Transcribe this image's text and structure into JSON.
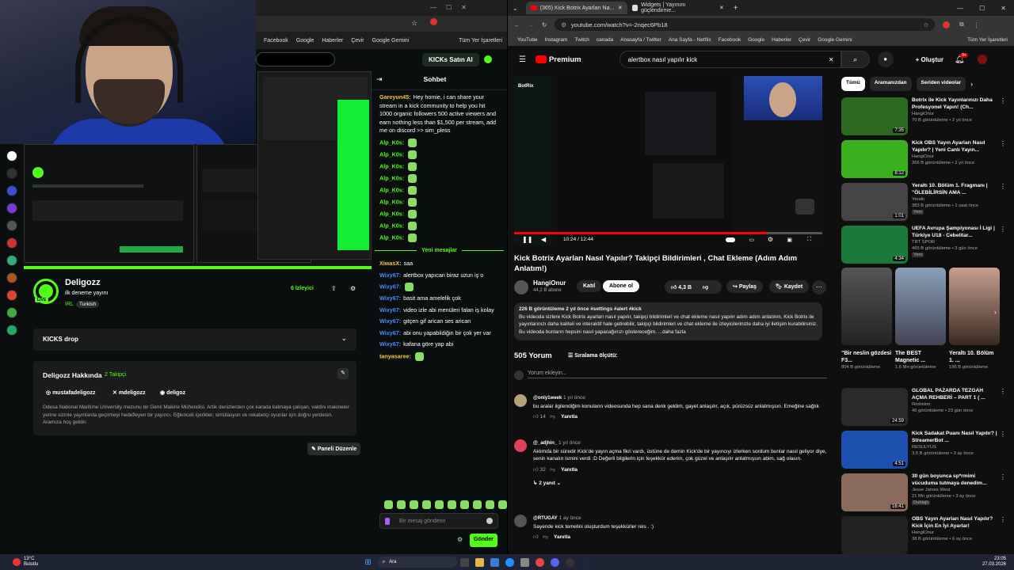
{
  "left": {
    "bookmarks": [
      "Facebook",
      "Google",
      "Haberler",
      "Çevir",
      "Google Gemini",
      "Tüm Yer İşaretleri"
    ],
    "kicks_button": "KICKs Satın Al",
    "chat_title": "Sohbet",
    "chat_messages": [
      {
        "user": "Gareyun45:",
        "text": "Hey homie, i can share your stream in a kick community to help you hit 1000 organic followers 500 active viewers and earn nothing less than $1,500 per stream, add me on discord >> sim_pless",
        "color": "y"
      },
      {
        "user": "Alp_K0s:",
        "text": "",
        "color": "g"
      },
      {
        "user": "Alp_K0s:",
        "text": "",
        "color": "g"
      },
      {
        "user": "Alp_K0s:",
        "text": "",
        "color": "g"
      },
      {
        "user": "Alp_K0s:",
        "text": "",
        "color": "g"
      },
      {
        "user": "Alp_K0s:",
        "text": "",
        "color": "g"
      },
      {
        "user": "Alp_K0s:",
        "text": "",
        "color": "g"
      },
      {
        "user": "Alp_K0s:",
        "text": "",
        "color": "g"
      },
      {
        "user": "Alp_K0s:",
        "text": "",
        "color": "g"
      },
      {
        "user": "Alp_K0s:",
        "text": "",
        "color": "g"
      }
    ],
    "new_messages": "Yeni mesajlar",
    "chat_messages2": [
      {
        "user": "XiwasX:",
        "text": "saa",
        "color": "y"
      },
      {
        "user": "Wixy67:",
        "text": "alertbox yapıcan biraz uzun iş o",
        "color": "b"
      },
      {
        "user": "Wixy67:",
        "text": "",
        "color": "b"
      },
      {
        "user": "Wixy67:",
        "text": "basit ama amelelik çok",
        "color": "b"
      },
      {
        "user": "Wixy67:",
        "text": "video izle abi menüleri falan iş kolay",
        "color": "b"
      },
      {
        "user": "Wixy67:",
        "text": "gitçen gif arican ses arican",
        "color": "b"
      },
      {
        "user": "Wixy67:",
        "text": "abi onu yapabildiğin bir çok yer var",
        "color": "b"
      },
      {
        "user": "Wixy67:",
        "text": "kafana göre yap abi",
        "color": "b"
      },
      {
        "user": "tanyasaree:",
        "text": "",
        "color": "y"
      }
    ],
    "chat_input_placeholder": "Bir mesaj gönderin",
    "send_button": "Gönder",
    "channel": {
      "name": "Deligozz",
      "stream_title": "ilk deneme yayını",
      "category": "IRL",
      "language": "Turkish",
      "viewers": "6 İzleyici",
      "kicks_drop": "KICKS drop",
      "about_title": "Deligozz Hakkında",
      "followers": "2 Takipçi",
      "instagram": "mustafadeligozz",
      "x": "mdeligozz",
      "discord": "deligoz",
      "bio": "Odesa National Maritime University mezunu bir Gemi Makine Mühendisi. Artık denizlerden çok karada kalmaya çalışan, vaktini makineler yerine sizinle yayınlarda geçirmeyi hedefleyen bir yayıncı. Eğlenceli içerikler, simülasyon ve rekabetçi oyunlar için doğru yerdesin. Aramıza hoş geldin",
      "edit_panels": "Paneli Düzenle"
    }
  },
  "right": {
    "tabs": [
      {
        "label": "(365) Kick Botrix Ayarları Na..."
      },
      {
        "label": "Widgets | Yayınını güçlendirme..."
      }
    ],
    "url": "youtube.com/watch?v=-2nqec6Pb18",
    "bookmarks": [
      "YouTube",
      "Instagram",
      "Twitch",
      "canada",
      "Anasayfa / Twitter",
      "Ana Sayfa - Netflix",
      "Facebook",
      "Google",
      "Haberler",
      "Çevir",
      "Google Gemini",
      "Tüm Yer İşaretleri"
    ],
    "search_query": "alertbox nasıl yapılır kick",
    "create_button": "Oluştur",
    "notif_count": "9+",
    "premium": "Premium",
    "time": "10:24 / 12:44",
    "video_title": "Kick Botrix Ayarları Nasıl Yapılır? Takipçi Bildirimleri , Chat Ekleme (Adım Adım Anlatım!)",
    "channel": "HangiOnur",
    "subs": "44,2 B abone",
    "join": "Katıl",
    "subscribe": "Abone ol",
    "likes": "4,3 B",
    "share": "Paylaş",
    "save": "Kaydet",
    "desc_meta": "226 B görüntüleme  2 yıl önce  #settings #alert #kick",
    "desc_text": "Bu videoda sizlere Kick Botrix ayarları nasıl yapılır, takipçi bildirimleri ve chat ekleme nasıl yapılır adım adım anlatılım. Kick Botrix ile yayınlarınızı daha kaliteli ve interaktif hale getirebilir, takipçi bildirimleri ve chat ekleme ile izleyicilerinizle daha iyi iletişim kurabilirsiniz. Bu videoda bunların hepsini nasıl yapacağınızı göstereceğim. ...daha fazla",
    "comments_count": "505 Yorum",
    "sort": "Sıralama ölçütü:",
    "add_comment": "Yorum ekleyin...",
    "comments": [
      {
        "user": "@only1week",
        "time": "1 yıl önce",
        "text": "bu aralar ilgilendiğim konuların videosunda hep sana denk geldim, gayet anlaşılır, açık,  pürüzsüz anlatmışsın. Emeğine sağlık",
        "likes": "14",
        "reply": "Yanıtla"
      },
      {
        "user": "@_adjhin_",
        "time": "1 yıl önce",
        "text": "Aklımda bir süredir Kick'de yayın açma fikri vardı, üstüne de demin Kick'de bir yayıncıyı izlerken sordum bunlar nasıl geliyor diye, senin kanalın ismini verdi :D Değerli bilgilerin için teşekkür ederim, çok güzel ve anlaşılır anlatmışsın abim, sağ olasın.",
        "likes": "32",
        "reply": "Yanıtla",
        "replies": "2 yanıt"
      },
      {
        "user": "@RTUGAY",
        "time": "1 ay önce",
        "text": "Sayende kick temelini oluşturdum teşekkürler reis . :)",
        "likes": "",
        "reply": "Yanıtla"
      }
    ],
    "chips": [
      "Tümü",
      "Aramanızdan",
      "Seriden videolar"
    ],
    "recs": [
      {
        "title": "Botrix ile Kick Yayınlarınızı Daha Profesyonel Yapın! (Ch...",
        "channel": "HangiOnur",
        "meta": "70 B görüntüleme • 2 yıl önce",
        "dur": "7:35",
        "color": "#2d6a1f"
      },
      {
        "title": "Kick OBS Yayın Ayarları Nasıl Yapılır? | Yeni Canlı Yayın...",
        "channel": "HangiOnur",
        "meta": "366 B görüntüleme • 2 yıl önce",
        "dur": "8:12",
        "color": "#3ab01e"
      },
      {
        "title": "Yeraltı 10. Bölüm 1. Fragmanı | \"ÖLEBİLİRSİN AMA ...",
        "channel": "Yeraltı",
        "meta": "383 B görüntüleme • 1 saat önce",
        "dur": "1:01",
        "badge": "Yeni",
        "color": "#444"
      },
      {
        "title": "UEFA Avrupa Şampiyonası İ Ligi | Türkiye U18 - Cebelitar...",
        "channel": "TRT SPOR",
        "meta": "465 B görüntüleme • 3 gün önce",
        "dur": "4:34",
        "badge": "Yeni",
        "color": "#1a7a3a"
      }
    ],
    "shorts": [
      {
        "title": "\"Bir neslin gözdesi F3...",
        "meta": "804 B görüntüleme"
      },
      {
        "title": "The BEST Magnetic ...",
        "meta": "1,6 Mn görüntüleme"
      },
      {
        "title": "Yeraltı 10. Bölüm 1. ...",
        "meta": "196 B görüntüleme"
      }
    ],
    "recs2": [
      {
        "title": "GLOBAL PAZARDA TEZGAH AÇMA REHBERİ – PART 1 ( ...",
        "channel": "Redreinn",
        "meta": "46 görüntüleme • 23 gün önce",
        "dur": "24:59",
        "color": "#2a2a2a"
      },
      {
        "title": "Kick Sadakat Puanı Nasıl Yapılır? | StreamerBot ...",
        "channel": "RESULYUS",
        "meta": "3,5 B görüntüleme • 3 ay önce",
        "dur": "4:51",
        "color": "#1e50b0"
      },
      {
        "title": "30 gün boyunca sp*rmimi vücuduma tutmaya denedim...",
        "channel": "Jesse James West",
        "meta": "21 Mn görüntüleme • 3 ay önce",
        "dur": "16:41",
        "badge": "Dublajlı",
        "color": "#8a6a5a"
      },
      {
        "title": "OBS Yayın Ayarları Nasıl Yapılır? Kick İçin En İyi Ayarlar!",
        "channel": "HangiOnur",
        "meta": "38 B görüntüleme • 6 ay önce",
        "dur": "",
        "color": "#222"
      }
    ]
  },
  "taskbar": {
    "weather": "13°C",
    "weather_desc": "Bulutlu",
    "search": "Ara",
    "time": "23:05",
    "date": "27.03.2026"
  },
  "colors": {
    "kick_green": "#53fc18",
    "yt_red": "#ff0000"
  }
}
